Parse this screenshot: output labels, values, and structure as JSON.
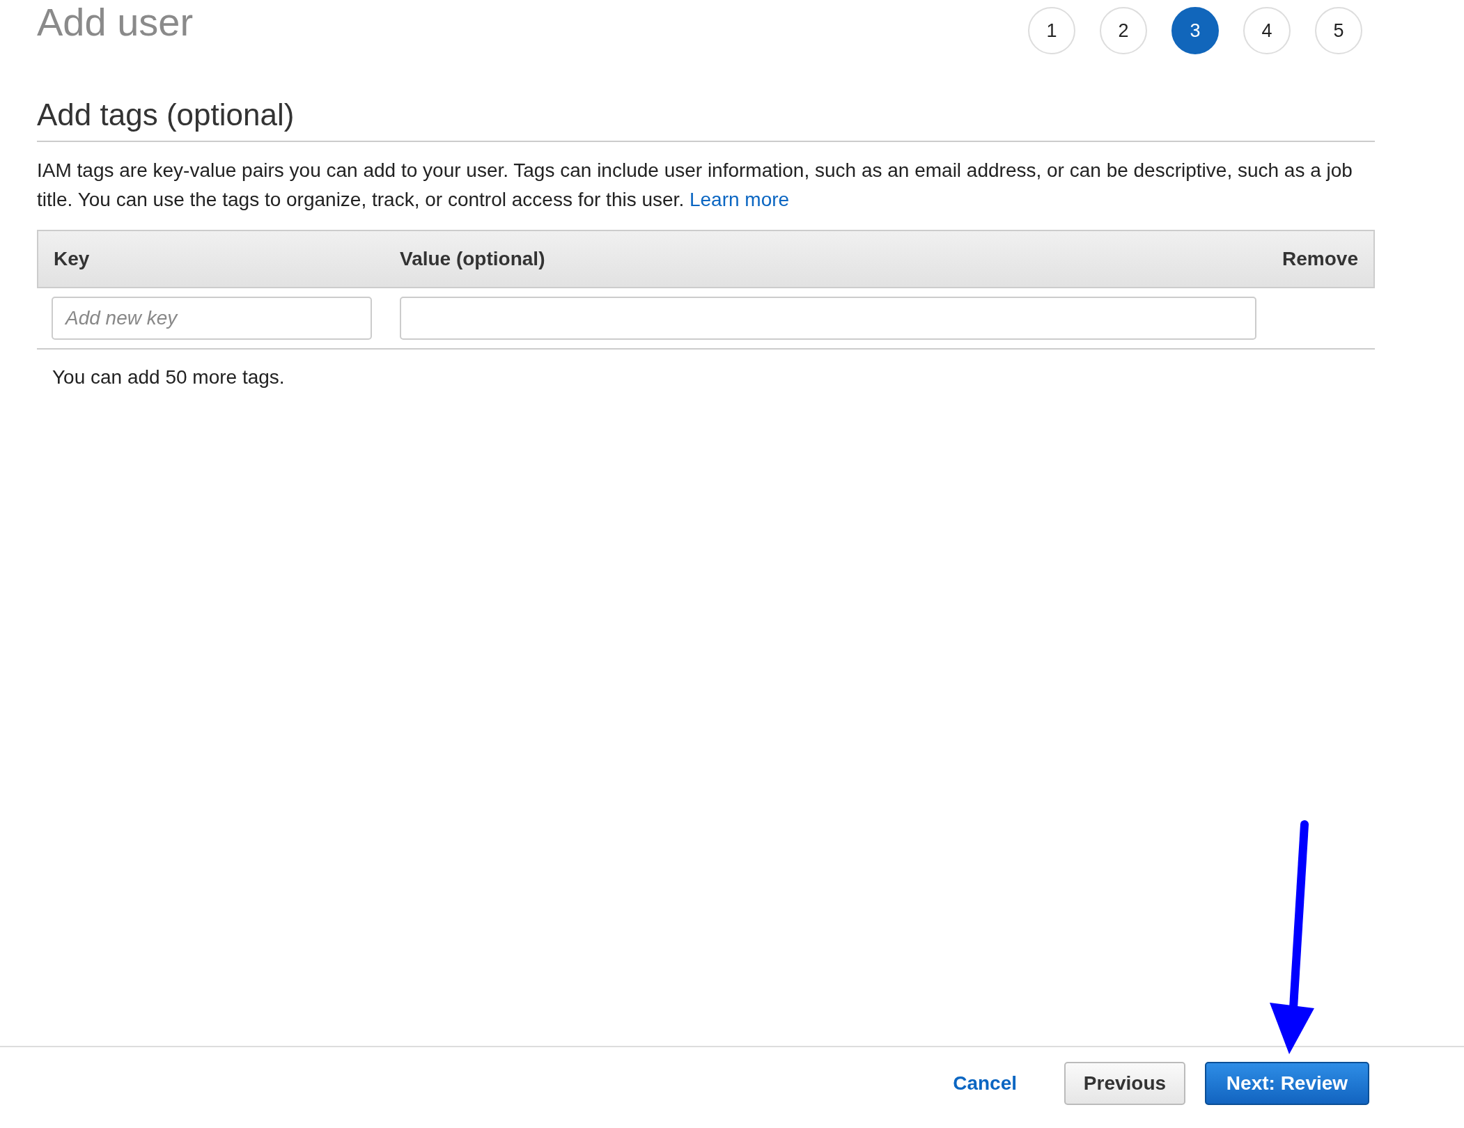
{
  "page": {
    "title": "Add user"
  },
  "steps": [
    {
      "label": "1",
      "selected": false
    },
    {
      "label": "2",
      "selected": false
    },
    {
      "label": "3",
      "selected": true
    },
    {
      "label": "4",
      "selected": false
    },
    {
      "label": "5",
      "selected": false
    }
  ],
  "section": {
    "heading": "Add tags (optional)",
    "description": "IAM tags are key-value pairs you can add to your user. Tags can include user information, such as an email address, or can be descriptive, such as a job title. You can use the tags to organize, track, or control access for this user.",
    "link": "Learn more"
  },
  "table": {
    "columns": [
      "Key",
      "Value (optional)",
      "Remove"
    ],
    "rows": [
      {
        "key_placeholder": "Add new key"
      }
    ],
    "note": "You can add 50 more tags."
  },
  "footer": {
    "buttons": [
      {
        "label": "Cancel",
        "kind": "link"
      },
      {
        "label": "Previous",
        "kind": "secondary"
      },
      {
        "label": "Next: Review",
        "kind": "primary"
      }
    ]
  }
}
